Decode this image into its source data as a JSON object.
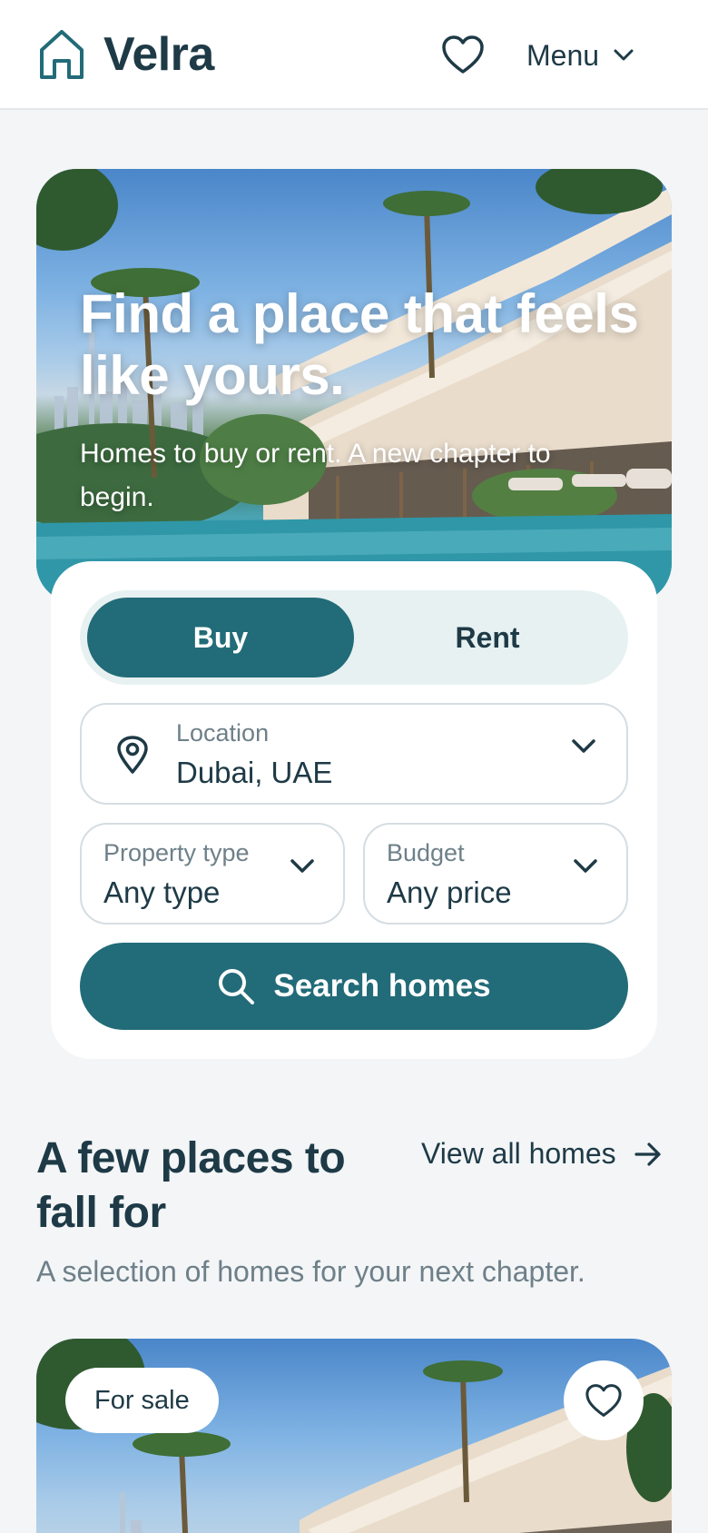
{
  "header": {
    "brand": "Velra",
    "menu_label": "Menu"
  },
  "hero": {
    "title": "Find a place that feels like yours.",
    "subtitle": "Homes to buy or rent. A new chapter to begin."
  },
  "search": {
    "tabs": {
      "buy": "Buy",
      "rent": "Rent",
      "selected": "Buy"
    },
    "location": {
      "label": "Location",
      "value": "Dubai, UAE"
    },
    "property_type": {
      "label": "Property type",
      "value": "Any type"
    },
    "budget": {
      "label": "Budget",
      "value": "Any price"
    },
    "button_label": "Search homes"
  },
  "section": {
    "title": "A few places to fall for",
    "view_all": "View all homes",
    "subtitle": "A selection of homes for your next chapter."
  },
  "listing": {
    "badge": "For sale"
  },
  "colors": {
    "primary": "#226b78",
    "text_dark": "#1e3a46",
    "text_muted": "#6e8089",
    "toggle_bg": "#e7f1f1",
    "page_bg": "#f3f5f7"
  }
}
